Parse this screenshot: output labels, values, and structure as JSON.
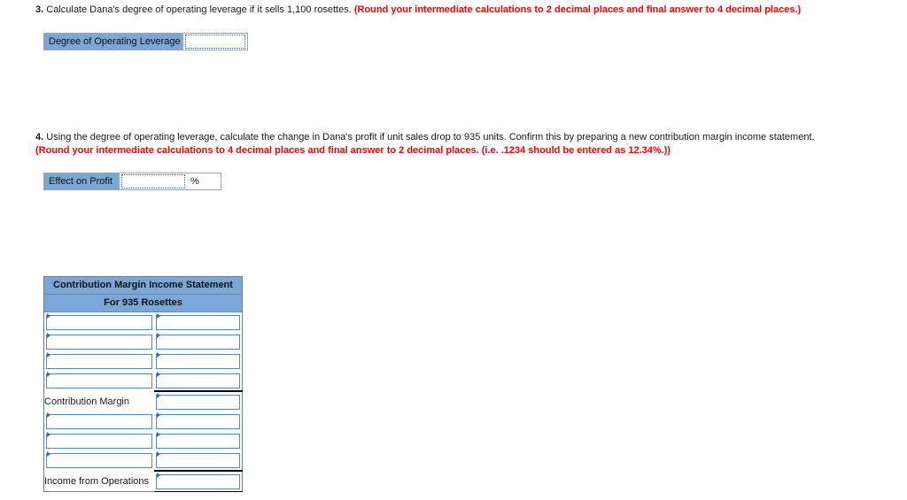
{
  "questions": [
    {
      "number": "3.",
      "text": "Calculate Dana's degree of operating leverage if it sells 1,100 rosettes.",
      "note": "(Round your intermediate calculations to 2 decimal places and final answer to 4 decimal places.)",
      "note2": ""
    },
    {
      "number": "4.",
      "text": "Using the degree of operating leverage, calculate the change in Dana's profit if unit sales drop to 935 units. Confirm this by preparing a new contribution margin income statement.",
      "note": "(Round your intermediate calculations to 4 decimal places and final answer to 2 decimal places. (i.e. .1234 should be entered as 12.34%.))",
      "note2": ""
    }
  ],
  "answers": {
    "dol": {
      "label": "Degree of Operating Leverage",
      "value": "",
      "placeholder": ""
    },
    "effect_on_profit": {
      "label": "Effect on Profit",
      "value": "",
      "placeholder": "",
      "unit": "%"
    }
  },
  "statement": {
    "title": "Contribution Margin Income Statement",
    "subtitle": "For 935 Rosettes",
    "columns": [
      "",
      ""
    ],
    "rows": [
      {
        "label": "",
        "label_editable": true,
        "value": "",
        "value_rule_top": false,
        "value_rule_bottom": false
      },
      {
        "label": "",
        "label_editable": true,
        "value": "",
        "value_rule_top": false,
        "value_rule_bottom": false
      },
      {
        "label": "",
        "label_editable": true,
        "value": "",
        "value_rule_top": false,
        "value_rule_bottom": false
      },
      {
        "label": "",
        "label_editable": true,
        "value": "",
        "value_rule_top": false,
        "value_rule_bottom": false
      },
      {
        "label": "Contribution Margin",
        "label_editable": false,
        "value": "",
        "value_rule_top": true,
        "value_rule_bottom": false
      },
      {
        "label": "",
        "label_editable": true,
        "value": "",
        "value_rule_top": false,
        "value_rule_bottom": false
      },
      {
        "label": "",
        "label_editable": true,
        "value": "",
        "value_rule_top": false,
        "value_rule_bottom": false
      },
      {
        "label": "",
        "label_editable": true,
        "value": "",
        "value_rule_top": false,
        "value_rule_bottom": false
      },
      {
        "label": "Income from Operations",
        "label_editable": false,
        "value": "",
        "value_rule_top": true,
        "value_rule_bottom": true
      }
    ]
  },
  "colors": {
    "header_blue": "#7BA7D7",
    "note_red": "#ff0000",
    "cell_border_blue": "#5b87b8",
    "dotted_border_blue": "#2f6fb5"
  }
}
